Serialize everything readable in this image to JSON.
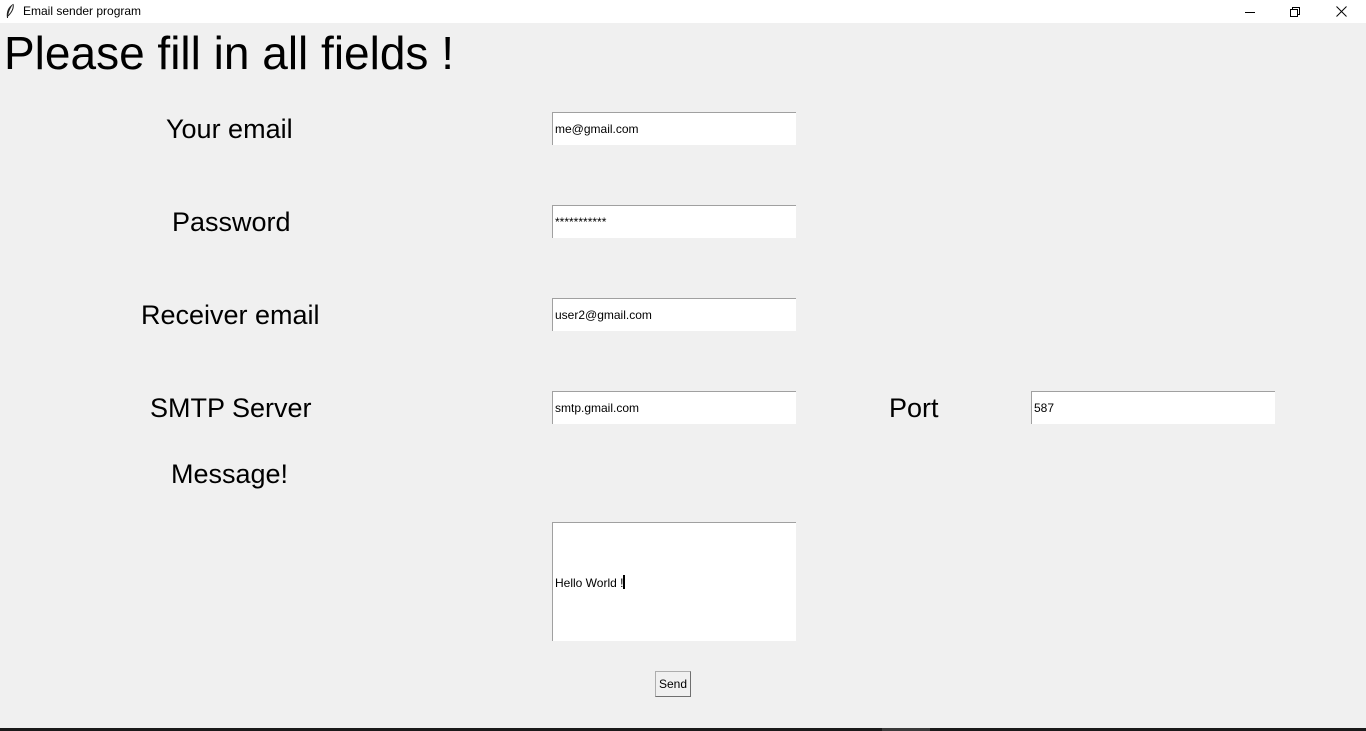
{
  "window": {
    "title": "Email sender program",
    "icon": "feather-icon",
    "controls": [
      "minimize-icon",
      "restore-icon",
      "close-icon"
    ]
  },
  "form": {
    "heading": "Please fill in all fields !",
    "your_email": {
      "label": "Your email",
      "value": "me@gmail.com"
    },
    "password": {
      "label": "Password",
      "value": "***********"
    },
    "receiver_email": {
      "label": "Receiver email",
      "value": "user2@gmail.com"
    },
    "smtp_server": {
      "label": "SMTP Server",
      "value": "smtp.gmail.com"
    },
    "port": {
      "label": "Port",
      "value": "587"
    },
    "message": {
      "label": "Message!",
      "value": "Hello World !"
    },
    "send_label": "Send"
  }
}
